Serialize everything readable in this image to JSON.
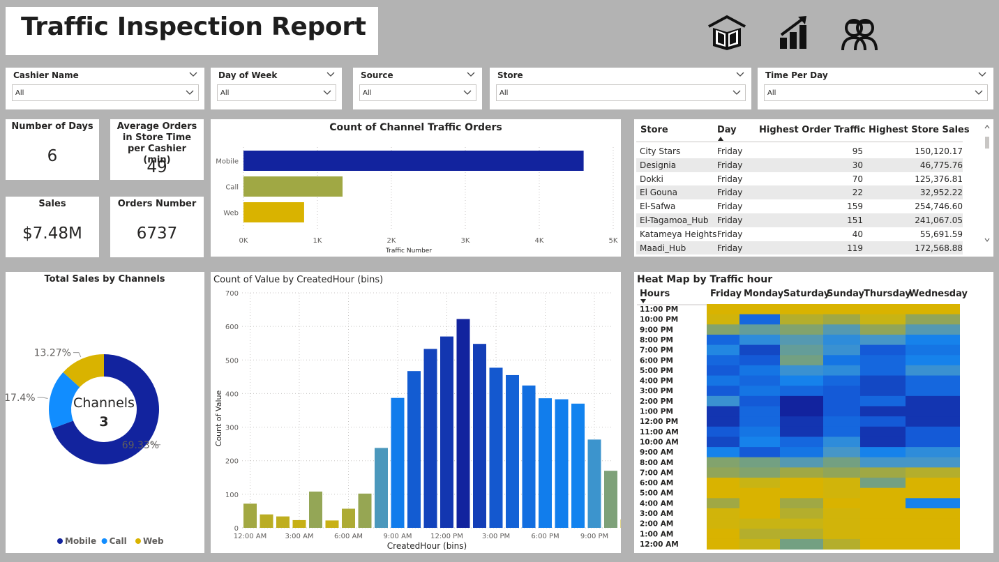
{
  "report_title": "Traffic Inspection Report",
  "nav_icons": [
    "home-book-icon",
    "bar-chart-icon",
    "people-icon"
  ],
  "slicers": [
    {
      "label": "Cashier Name",
      "value": "All"
    },
    {
      "label": "Day of Week",
      "value": "All"
    },
    {
      "label": "Source",
      "value": "All"
    },
    {
      "label": "Store",
      "value": "All"
    },
    {
      "label": "Time Per Day",
      "value": "All"
    }
  ],
  "kpis": {
    "days": {
      "label": "Number of Days",
      "value": "6"
    },
    "avg_orders": {
      "label": "Average Orders in Store Time per Cashier (min)",
      "value": "49"
    },
    "sales": {
      "label": "Sales",
      "value": "$7.48M"
    },
    "orders": {
      "label": "Orders Number",
      "value": "6737"
    }
  },
  "table": {
    "headers": [
      "Store",
      "Day",
      "Highest Order Traffic",
      "Highest Store Sales"
    ],
    "rows": [
      [
        "City Stars",
        "Friday",
        "95",
        "150,120.17"
      ],
      [
        "Designia",
        "Friday",
        "30",
        "46,775.76"
      ],
      [
        "Dokki",
        "Friday",
        "70",
        "125,376.81"
      ],
      [
        "El Gouna",
        "Friday",
        "22",
        "32,952.22"
      ],
      [
        "El-Safwa",
        "Friday",
        "159",
        "254,746.60"
      ],
      [
        "El-Tagamoa_Hub",
        "Friday",
        "151",
        "241,067.05"
      ],
      [
        "Katameya Heights",
        "Friday",
        "40",
        "55,691.59"
      ],
      [
        "Maadi_Hub",
        "Friday",
        "119",
        "172,568.88"
      ]
    ]
  },
  "colors": {
    "mobile": "#12239e",
    "call": "#a0a844",
    "web": "#d9b300",
    "sales_call": "#118dff"
  },
  "chart_data": [
    {
      "type": "bar",
      "orientation": "horizontal",
      "title": "Count of Channel Traffic Orders",
      "xlabel": "Traffic Number",
      "categories": [
        "Mobile",
        "Call",
        "Web"
      ],
      "values": [
        4600,
        1340,
        820
      ],
      "xlim": [
        0,
        5000
      ],
      "xticks": [
        "0K",
        "1K",
        "2K",
        "3K",
        "4K",
        "5K"
      ],
      "grid": true
    },
    {
      "type": "pie",
      "donut": true,
      "title": "Total Sales by Channels",
      "center_label": "Channels",
      "center_value": "3",
      "slices": [
        {
          "name": "Mobile",
          "value": 69.33,
          "label": "69.33%"
        },
        {
          "name": "Call",
          "value": 17.4,
          "label": "17.4%"
        },
        {
          "name": "Web",
          "value": 13.27,
          "label": "13.27%"
        }
      ],
      "legend": "bottom"
    },
    {
      "type": "bar",
      "title": "Count of Value by CreatedHour (bins)",
      "xlabel": "CreatedHour (bins)",
      "ylabel": "Count of Value",
      "ylim": [
        0,
        700
      ],
      "yticks": [
        0,
        100,
        200,
        300,
        400,
        500,
        600,
        700
      ],
      "xticks": [
        "12:00 AM",
        "3:00 AM",
        "6:00 AM",
        "9:00 AM",
        "12:00 PM",
        "3:00 PM",
        "6:00 PM",
        "9:00 PM"
      ],
      "values": [
        72,
        40,
        34,
        23,
        108,
        22,
        57,
        102,
        238,
        387,
        467,
        533,
        570,
        622,
        548,
        477,
        455,
        424,
        386,
        383,
        370,
        263,
        170,
        25
      ],
      "grid": true
    },
    {
      "type": "heatmap",
      "title": "Heat Map by Traffic hour",
      "row_header": "Hours",
      "columns": [
        "Friday",
        "Monday",
        "Saturday",
        "Sunday",
        "Thursday",
        "Wednesday"
      ],
      "rows": [
        "11:00 PM",
        "10:00 PM",
        "9:00 PM",
        "8:00 PM",
        "7:00 PM",
        "6:00 PM",
        "5:00 PM",
        "4:00 PM",
        "3:00 PM",
        "2:00 PM",
        "1:00 PM",
        "12:00 PM",
        "11:00 AM",
        "10:00 AM",
        "9:00 AM",
        "8:00 AM",
        "7:00 AM",
        "6:00 AM",
        "5:00 AM",
        "4:00 AM",
        "3:00 AM",
        "2:00 AM",
        "1:00 AM",
        "12:00 AM"
      ],
      "values": [
        [
          0.0,
          0.0,
          0.0,
          0.0,
          0.0,
          0.0
        ],
        [
          0.05,
          0.8,
          0.15,
          0.2,
          0.1,
          0.25
        ],
        [
          0.3,
          0.4,
          0.3,
          0.45,
          0.25,
          0.45
        ],
        [
          0.8,
          0.6,
          0.45,
          0.6,
          0.5,
          0.7
        ],
        [
          0.65,
          0.9,
          0.4,
          0.55,
          0.85,
          0.75
        ],
        [
          0.8,
          0.85,
          0.35,
          0.75,
          0.8,
          0.7
        ],
        [
          0.85,
          0.75,
          0.55,
          0.6,
          0.8,
          0.55
        ],
        [
          0.75,
          0.8,
          0.7,
          0.8,
          0.9,
          0.8
        ],
        [
          0.85,
          0.75,
          0.8,
          0.85,
          0.9,
          0.8
        ],
        [
          0.55,
          0.85,
          1.0,
          0.85,
          0.8,
          0.95
        ],
        [
          0.95,
          0.8,
          1.0,
          0.85,
          0.95,
          0.95
        ],
        [
          0.95,
          0.8,
          0.95,
          0.8,
          0.85,
          0.95
        ],
        [
          0.85,
          0.75,
          0.95,
          0.8,
          0.95,
          0.85
        ],
        [
          0.9,
          0.7,
          0.8,
          0.6,
          0.95,
          0.85
        ],
        [
          0.7,
          0.85,
          0.75,
          0.5,
          0.7,
          0.6
        ],
        [
          0.3,
          0.35,
          0.45,
          0.35,
          0.5,
          0.5
        ],
        [
          0.25,
          0.3,
          0.2,
          0.25,
          0.2,
          0.15
        ],
        [
          0.0,
          0.1,
          0.0,
          0.05,
          0.35,
          0.0
        ],
        [
          0.0,
          0.0,
          0.0,
          0.05,
          0.0,
          0.0
        ],
        [
          0.2,
          0.0,
          0.2,
          0.0,
          0.0,
          0.7
        ],
        [
          0.05,
          0.0,
          0.15,
          0.05,
          0.0,
          0.0
        ],
        [
          0.05,
          0.1,
          0.1,
          0.05,
          0.0,
          0.0
        ],
        [
          0.0,
          0.15,
          0.15,
          0.05,
          0.0,
          0.0
        ],
        [
          0.0,
          0.1,
          0.35,
          0.15,
          0.0,
          0.0
        ]
      ]
    }
  ]
}
